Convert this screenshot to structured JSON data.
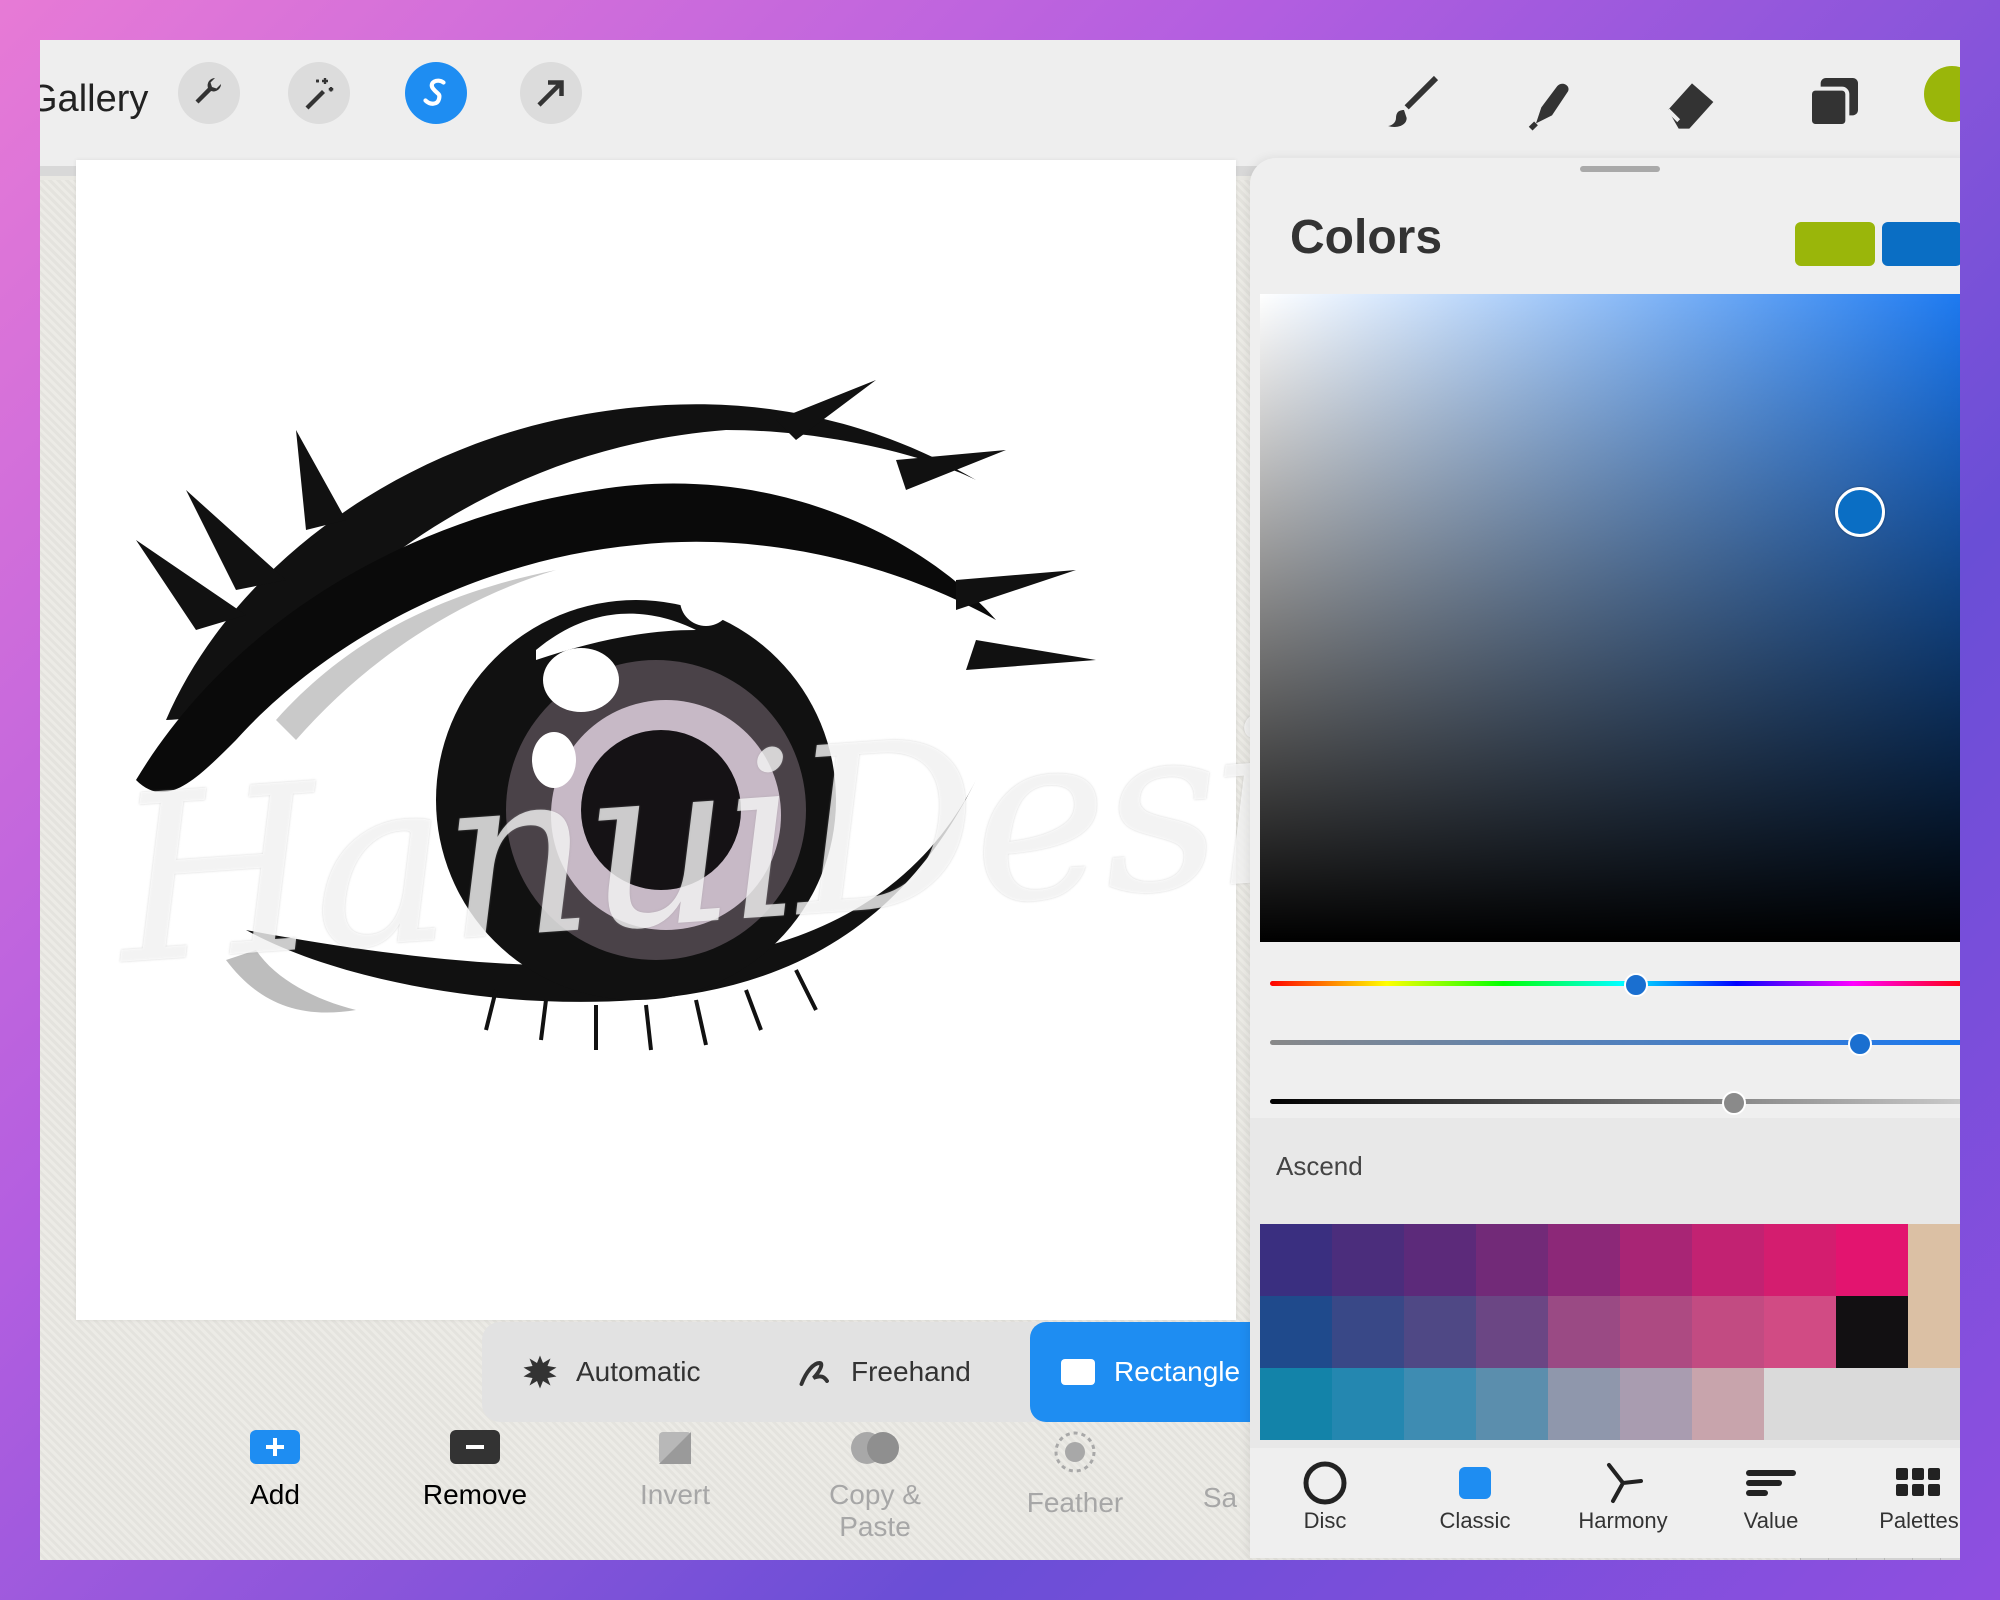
{
  "toolbar": {
    "gallery_label": "Gallery",
    "left_icons": [
      "wrench-icon",
      "magic-wand-icon",
      "selection-icon",
      "transform-arrow-icon"
    ],
    "right_icons": [
      "brush-icon",
      "smudge-icon",
      "eraser-icon",
      "layers-icon"
    ],
    "current_color": "#9ab60a"
  },
  "canvas": {
    "watermark": "HanuiDesignID"
  },
  "selection_modes": [
    {
      "label": "Automatic",
      "icon": "automatic-gear-icon",
      "active": false
    },
    {
      "label": "Freehand",
      "icon": "freehand-icon",
      "active": false
    },
    {
      "label": "Rectangle",
      "icon": "rectangle-icon",
      "active": true
    }
  ],
  "selection_actions": [
    {
      "label": "Add",
      "icon": "plus-icon",
      "enabled": true
    },
    {
      "label": "Remove",
      "icon": "minus-icon",
      "enabled": true
    },
    {
      "label": "Invert",
      "icon": "invert-icon",
      "enabled": false
    },
    {
      "label": "Copy & Paste",
      "icon": "copy-paste-icon",
      "enabled": false
    },
    {
      "label": "Feather",
      "icon": "feather-icon",
      "enabled": false
    },
    {
      "label": "Sa",
      "icon": "save-icon",
      "enabled": false
    }
  ],
  "colors_panel": {
    "title": "Colors",
    "primary_swatch": "#9ab60a",
    "secondary_swatch": "#0a6ec4",
    "palette_name": "Ascend",
    "palette_rows": [
      [
        "#3a2f80",
        "#4b2d7c",
        "#5c2a7a",
        "#722a78",
        "#8c2878",
        "#a82575",
        "#c22272",
        "#d41d6f",
        "#e3146f",
        "#dbc0a4"
      ],
      [
        "#1f4a8c",
        "#394887",
        "#4f4885",
        "#6b4684",
        "#9a4a84",
        "#ad4a82",
        "#c24b82",
        "#d14b84",
        "#121012",
        "#dbc0a4"
      ],
      [
        "#1383a9",
        "#2487b0",
        "#3e8cb2",
        "#5b8ead",
        "#8f97ac",
        "#a99cb0",
        "#c8a4ac",
        "#dadada",
        "#dadada",
        "#dadada"
      ]
    ],
    "tabs": [
      {
        "label": "Disc",
        "icon": "disc-icon",
        "active": false
      },
      {
        "label": "Classic",
        "icon": "classic-square-icon",
        "active": true
      },
      {
        "label": "Harmony",
        "icon": "harmony-icon",
        "active": false
      },
      {
        "label": "Value",
        "icon": "value-bars-icon",
        "active": false
      },
      {
        "label": "Palettes",
        "icon": "palettes-grid-icon",
        "active": false
      }
    ],
    "hue_level": 0.52,
    "saturation_level": 0.84,
    "brightness_level": 0.66
  }
}
